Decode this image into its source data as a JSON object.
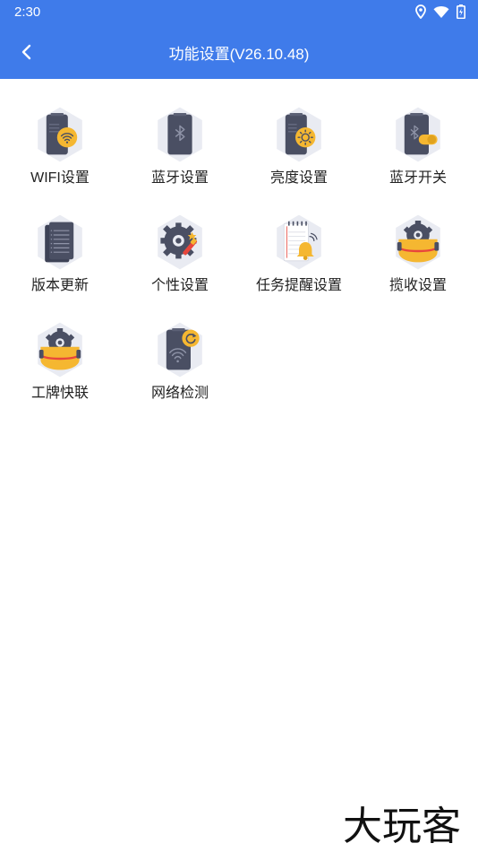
{
  "status": {
    "time": "2:30"
  },
  "header": {
    "title": "功能设置(V26.10.48)"
  },
  "tiles": [
    {
      "label": "WIFI设置",
      "icon": "wifi-settings-icon"
    },
    {
      "label": "蓝牙设置",
      "icon": "bluetooth-settings-icon"
    },
    {
      "label": "亮度设置",
      "icon": "brightness-settings-icon"
    },
    {
      "label": "蓝牙开关",
      "icon": "bluetooth-switch-icon"
    },
    {
      "label": "版本更新",
      "icon": "version-update-icon"
    },
    {
      "label": "个性设置",
      "icon": "personalize-icon"
    },
    {
      "label": "任务提醒设置",
      "icon": "task-reminder-icon"
    },
    {
      "label": "揽收设置",
      "icon": "pickup-settings-icon"
    },
    {
      "label": "工牌快联",
      "icon": "badge-quick-connect-icon"
    },
    {
      "label": "网络检测",
      "icon": "network-check-icon"
    }
  ],
  "watermark": "大玩客",
  "colors": {
    "primary": "#3F7BEA",
    "accent": "#F5B731",
    "device": "#4A4F63",
    "hex_bg": "#E9EBF2"
  }
}
